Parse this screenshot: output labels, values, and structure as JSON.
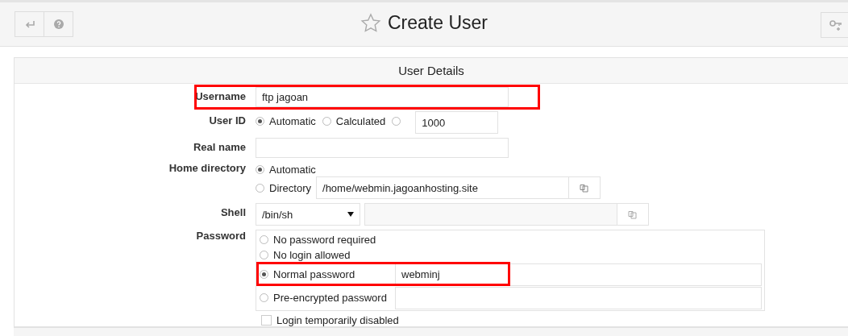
{
  "header": {
    "title": "Create User",
    "starred": false
  },
  "section": {
    "title": "User Details"
  },
  "fields": [
    {
      "kind": "text",
      "label": "Username",
      "value": "ftp jagoan",
      "highlighted": true
    },
    {
      "kind": "radio-inline",
      "label": "User ID",
      "value": "1000",
      "options": [
        {
          "label": "Automatic",
          "selected": true
        },
        {
          "label": "Calculated",
          "selected": false
        },
        {
          "selected": false
        }
      ]
    },
    {
      "kind": "text",
      "label": "Real name",
      "highlighted": false
    },
    {
      "kind": "radio-stack",
      "label": "Home directory",
      "options": [
        {
          "kind": "plain",
          "label": "Automatic",
          "selected": true
        },
        {
          "kind": "input-chooser",
          "label": "Directory",
          "selected": false,
          "value": "/home/webmin.jagoanhosting.site"
        }
      ]
    },
    {
      "kind": "select",
      "label": "Shell",
      "value": "/bin/sh"
    },
    {
      "kind": "radio-box",
      "label": "Password",
      "options": [
        {
          "kind": "plain",
          "label": "No password required",
          "selected": false
        },
        {
          "kind": "plain",
          "label": "No login allowed",
          "selected": false
        },
        {
          "kind": "input",
          "label": "Normal password",
          "selected": true,
          "value": "webminj",
          "highlighted": true
        },
        {
          "kind": "input",
          "label": "Pre-encrypted password",
          "selected": false
        }
      ],
      "checkbox": {
        "label": "Login temporarily disabled",
        "checked": false
      }
    }
  ]
}
